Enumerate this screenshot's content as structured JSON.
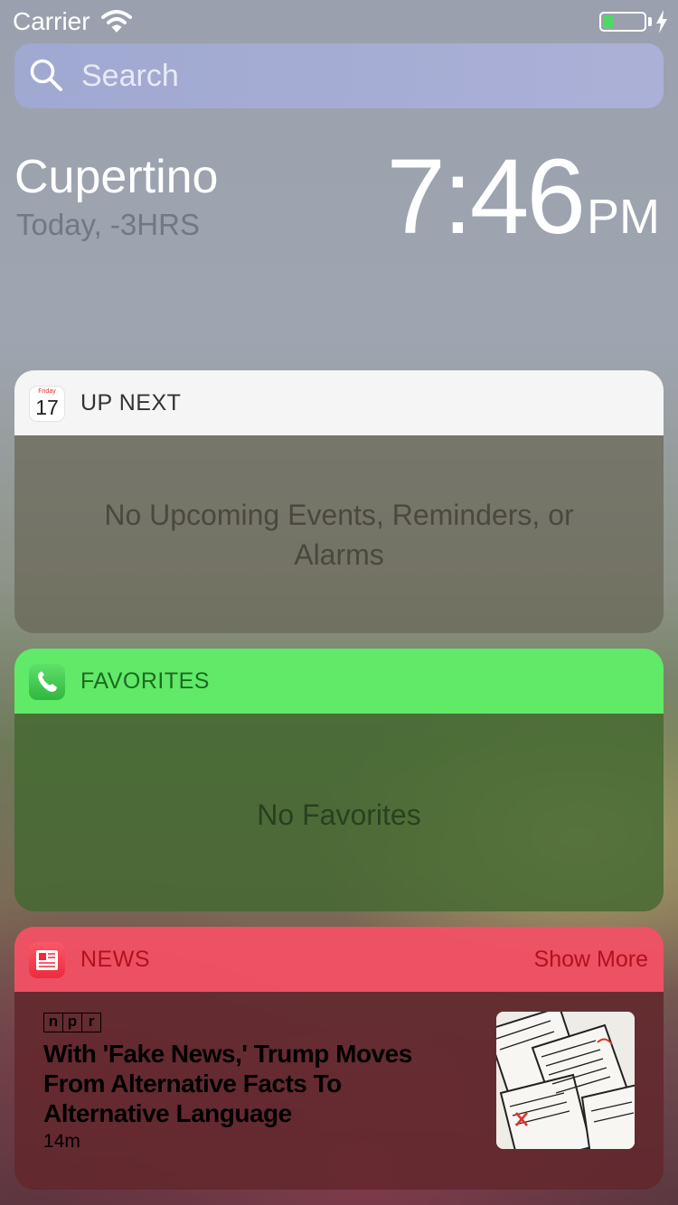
{
  "status_bar": {
    "carrier": "Carrier",
    "battery_level": 0.25
  },
  "search": {
    "placeholder": "Search"
  },
  "clock": {
    "city": "Cupertino",
    "subtitle": "Today, -3HRS",
    "time": "7:46",
    "ampm": "PM"
  },
  "widgets": {
    "up_next": {
      "title": "UP NEXT",
      "calendar_day": "Friday",
      "calendar_date": "17",
      "empty_line1": "No Upcoming Events, Reminders, or",
      "empty_line2": "Alarms"
    },
    "favorites": {
      "title": "FAVORITES",
      "empty": "No Favorites"
    },
    "news": {
      "title": "NEWS",
      "show_more": "Show More",
      "source": [
        "n",
        "p",
        "r"
      ],
      "headline": "With 'Fake News,' Trump Moves From Alternative Facts To Alternative Language",
      "age": "14m"
    }
  },
  "colors": {
    "favorites_header": "#60ec68",
    "news_header": "#f05264",
    "news_accent": "#b4101e",
    "battery_green": "#4cd964"
  },
  "icons": [
    "wifi-icon",
    "battery-icon",
    "charging-bolt-icon",
    "search-icon",
    "calendar-icon",
    "phone-icon",
    "news-icon"
  ]
}
